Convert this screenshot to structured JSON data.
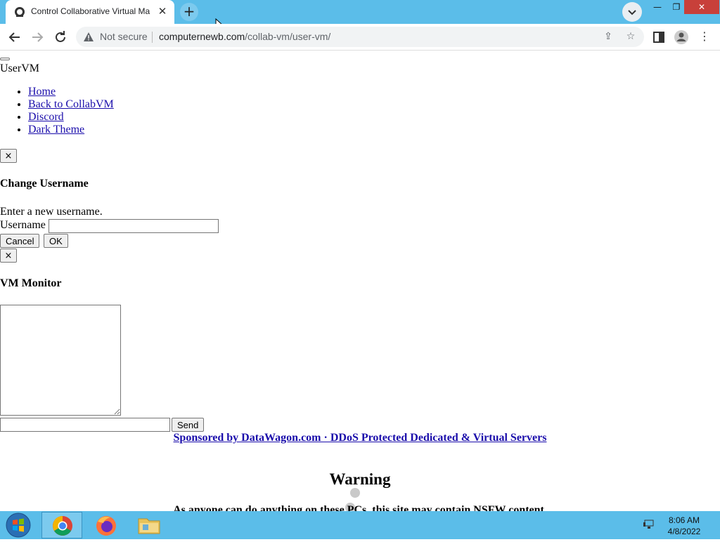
{
  "browser": {
    "tab_title": "Control Collaborative Virtual Ma",
    "new_tab_label": "+",
    "not_secure": "Not secure",
    "url_host": "computernewb.com",
    "url_path": "/collab-vm/user-vm/"
  },
  "page": {
    "brand": "UserVM",
    "nav": [
      "Home",
      "Back to CollabVM",
      "Discord",
      "Dark Theme"
    ],
    "close_label": "×",
    "username_modal": {
      "title": "Change Username",
      "prompt": "Enter a new username.",
      "field_label": "Username",
      "cancel_label": "Cancel",
      "ok_label": "OK"
    },
    "monitor_modal": {
      "title": "VM Monitor",
      "send_label": "Send"
    },
    "sponsor": "Sponsored by DataWagon.com · DDoS Protected Dedicated & Virtual Servers",
    "warning_title": "Warning",
    "warning_text": "As anyone can do anything on these PCs, this site may contain NSFW content."
  },
  "taskbar": {
    "time": "8:06 AM",
    "date": "4/8/2022",
    "apps": [
      "chrome-icon",
      "firefox-icon",
      "file-explorer-icon"
    ]
  },
  "colors": {
    "chrome_blue": "#5bbde9",
    "link": "#1a0dab"
  }
}
